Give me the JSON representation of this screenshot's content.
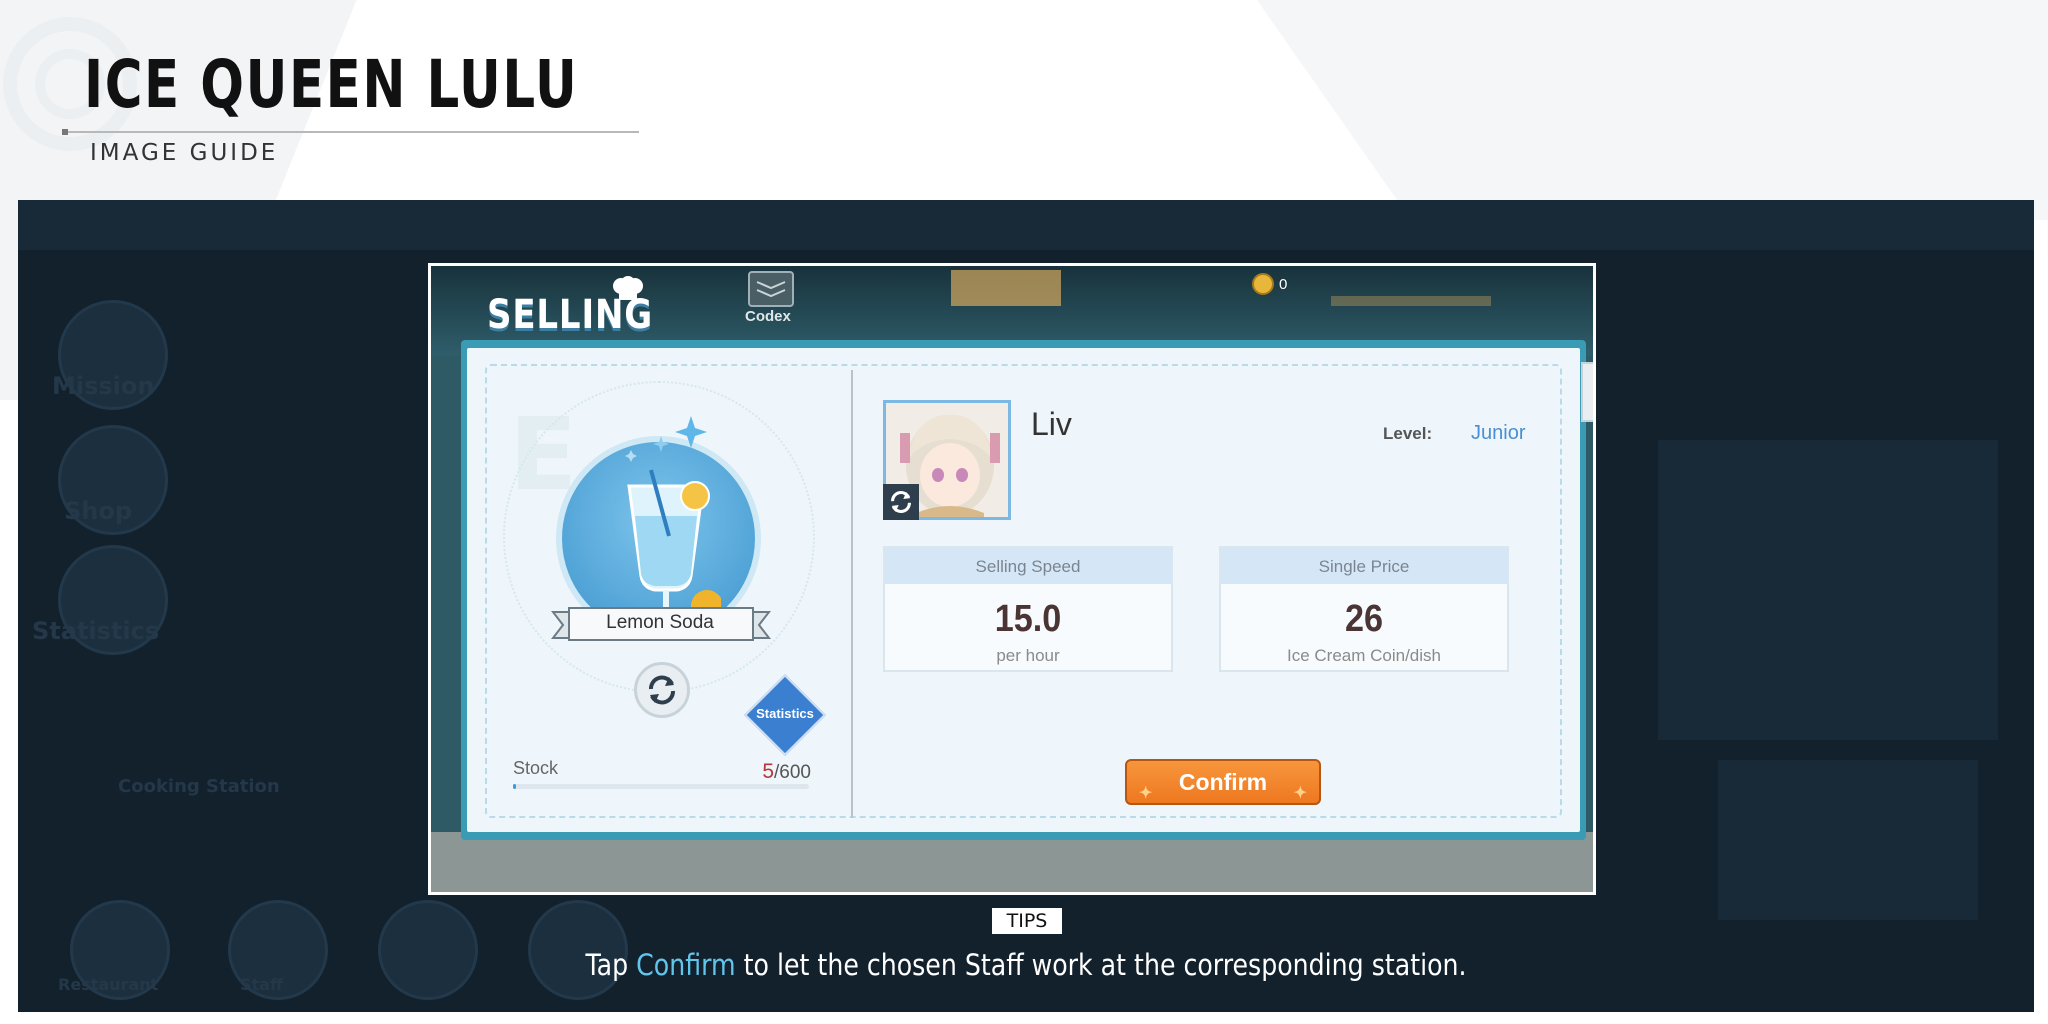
{
  "header": {
    "title": "ICE QUEEN LULU",
    "subtitle": "IMAGE GUIDE"
  },
  "game": {
    "screen_title": "SELLING",
    "codex_label": "Codex",
    "coin_count": "0",
    "dish": {
      "name": "Lemon Soda",
      "icon": "lemon-soda-icon",
      "stock_label": "Stock",
      "stock_current": "5",
      "stock_max": "/600",
      "stock_fraction": 0.0083
    },
    "statistics_label": "Statistics",
    "staff": {
      "name": "Liv",
      "level_label": "Level:",
      "level_value": "Junior"
    },
    "selling_speed": {
      "label": "Selling Speed",
      "value": "15.0",
      "unit": "per hour"
    },
    "single_price": {
      "label": "Single Price",
      "value": "26",
      "unit": "Ice Cream Coin/dish"
    },
    "confirm_label": "Confirm"
  },
  "tips": {
    "badge": "TIPS",
    "prefix": "Tap ",
    "highlight": "Confirm",
    "suffix": " to let the chosen Staff work at the corresponding station."
  },
  "colors": {
    "stage_bg": "#13212d",
    "panel_border": "#3a9bb4",
    "confirm_orange": "#f08426",
    "highlight_blue": "#62c6ec",
    "level_blue": "#4a8fd3",
    "stock_red": "#b5373a"
  },
  "background_labels": {
    "mission": "Mission",
    "shop": "Shop",
    "statistics": "Statistics",
    "cooking_station": "Cooking Station",
    "restaurant": "Restaurant",
    "staff": "Staff"
  }
}
